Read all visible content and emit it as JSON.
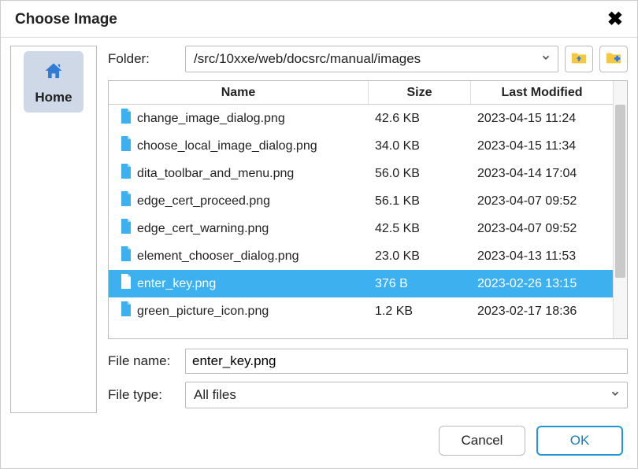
{
  "title": "Choose Image",
  "sidebar": {
    "home_label": "Home"
  },
  "folder": {
    "label": "Folder:",
    "path": "/src/10xxe/web/docsrc/manual/images"
  },
  "columns": {
    "name": "Name",
    "size": "Size",
    "modified": "Last Modified"
  },
  "files": [
    {
      "name": "change_image_dialog.png",
      "size": "42.6 KB",
      "modified": "2023-04-15 11:24",
      "selected": false
    },
    {
      "name": "choose_local_image_dialog.png",
      "size": "34.0 KB",
      "modified": "2023-04-15 11:34",
      "selected": false
    },
    {
      "name": "dita_toolbar_and_menu.png",
      "size": "56.0 KB",
      "modified": "2023-04-14 17:04",
      "selected": false
    },
    {
      "name": "edge_cert_proceed.png",
      "size": "56.1 KB",
      "modified": "2023-04-07 09:52",
      "selected": false
    },
    {
      "name": "edge_cert_warning.png",
      "size": "42.5 KB",
      "modified": "2023-04-07 09:52",
      "selected": false
    },
    {
      "name": "element_chooser_dialog.png",
      "size": "23.0 KB",
      "modified": "2023-04-13 11:53",
      "selected": false
    },
    {
      "name": "enter_key.png",
      "size": "376 B",
      "modified": "2023-02-26 13:15",
      "selected": true
    },
    {
      "name": "green_picture_icon.png",
      "size": "1.2 KB",
      "modified": "2023-02-17 18:36",
      "selected": false
    }
  ],
  "filename": {
    "label": "File name:",
    "value": "enter_key.png"
  },
  "filetype": {
    "label": "File type:",
    "value": "All files"
  },
  "buttons": {
    "cancel": "Cancel",
    "ok": "OK"
  }
}
